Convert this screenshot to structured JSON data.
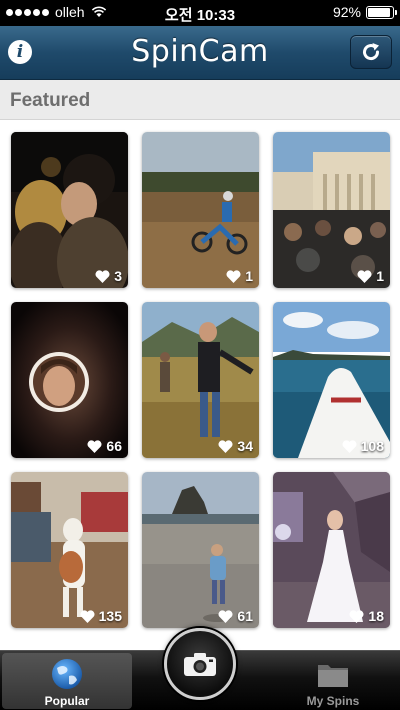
{
  "status_bar": {
    "carrier": "olleh",
    "time": "오전 10:33",
    "battery_percent": "92%",
    "battery_level": 0.92
  },
  "navbar": {
    "title": "SpinCam",
    "info_icon": "info-icon",
    "refresh_icon": "refresh-icon"
  },
  "section": {
    "title": "Featured"
  },
  "tiles": [
    {
      "likes": "3",
      "scene": "couple at night"
    },
    {
      "likes": "1",
      "scene": "dirt bike rider"
    },
    {
      "likes": "1",
      "scene": "crowd at plaza"
    },
    {
      "likes": "66",
      "scene": "portrait in circle"
    },
    {
      "likes": "34",
      "scene": "man in field"
    },
    {
      "likes": "108",
      "scene": "surfboard on water"
    },
    {
      "likes": "135",
      "scene": "dog standing"
    },
    {
      "likes": "61",
      "scene": "child on beach"
    },
    {
      "likes": "18",
      "scene": "woman in white dress"
    }
  ],
  "tabbar": {
    "tabs": [
      {
        "label": "Popular",
        "icon": "globe-icon",
        "selected": true
      },
      {
        "label": "My Spins",
        "icon": "folder-icon",
        "selected": false
      }
    ],
    "center_icon": "camera-icon"
  },
  "colors": {
    "nav_blue": "#1f4a6b",
    "section_bg": "#ebebeb",
    "section_text": "#6e6e6e"
  }
}
